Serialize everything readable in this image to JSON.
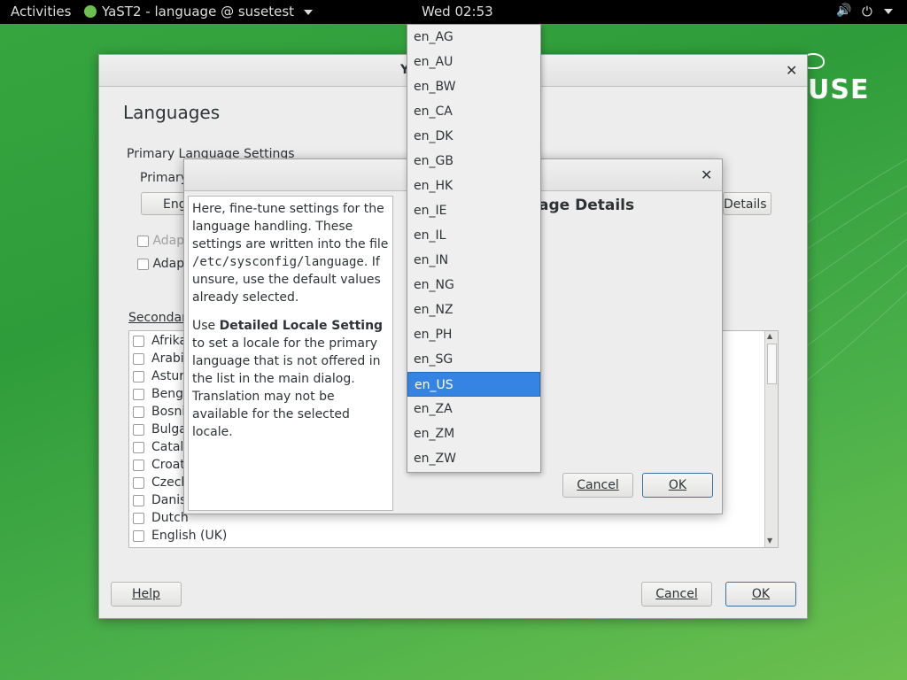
{
  "topbar": {
    "activities": "Activities",
    "app_menu": "YaST2 - language @ susetest",
    "clock": "Wed 02:53"
  },
  "desktop": {
    "brand_fragment": "USE"
  },
  "main_dialog": {
    "title_fragment": "Y",
    "heading": "Languages",
    "primary_section": "Primary Language Settings",
    "primary_label": "Primary",
    "primary_combo_value": "Eng",
    "details_button": "Details",
    "adapt_1": "Adap",
    "adapt_2": "Adapt",
    "secondary_label": "Secondary",
    "secondary_languages": [
      "Afrikaans",
      "Arabic",
      "Asturian",
      "Bengali",
      "Bosnian",
      "Bulgarian",
      "Catalan",
      "Croatian",
      "Czech",
      "Danish",
      "Dutch",
      "English (UK)"
    ],
    "help_button": "Help",
    "cancel_button": "Cancel",
    "ok_button": "OK"
  },
  "details_dialog": {
    "heading_fragment": "age Details",
    "help_text": {
      "p1_a": "Here, fine-tune settings for the language handling. These settings are written into the file ",
      "p1_file": "/etc/sysconfig/language",
      "p1_b": ". If unsure, use the default values already selected.",
      "p2_a": "Use ",
      "p2_bold": "Detailed Locale Setting",
      "p2_b": " to set a locale for the primary language that is not offered in the list in the main dialog. Translation may not be available for the selected locale."
    },
    "cancel_button": "Cancel",
    "ok_button": "OK"
  },
  "locale_popup": {
    "options": [
      "en_AG",
      "en_AU",
      "en_BW",
      "en_CA",
      "en_DK",
      "en_GB",
      "en_HK",
      "en_IE",
      "en_IL",
      "en_IN",
      "en_NG",
      "en_NZ",
      "en_PH",
      "en_SG",
      "en_US",
      "en_ZA",
      "en_ZM",
      "en_ZW"
    ],
    "selected": "en_US"
  },
  "colors": {
    "accent": "#3584e4",
    "desktop_green": "#37a63f"
  }
}
